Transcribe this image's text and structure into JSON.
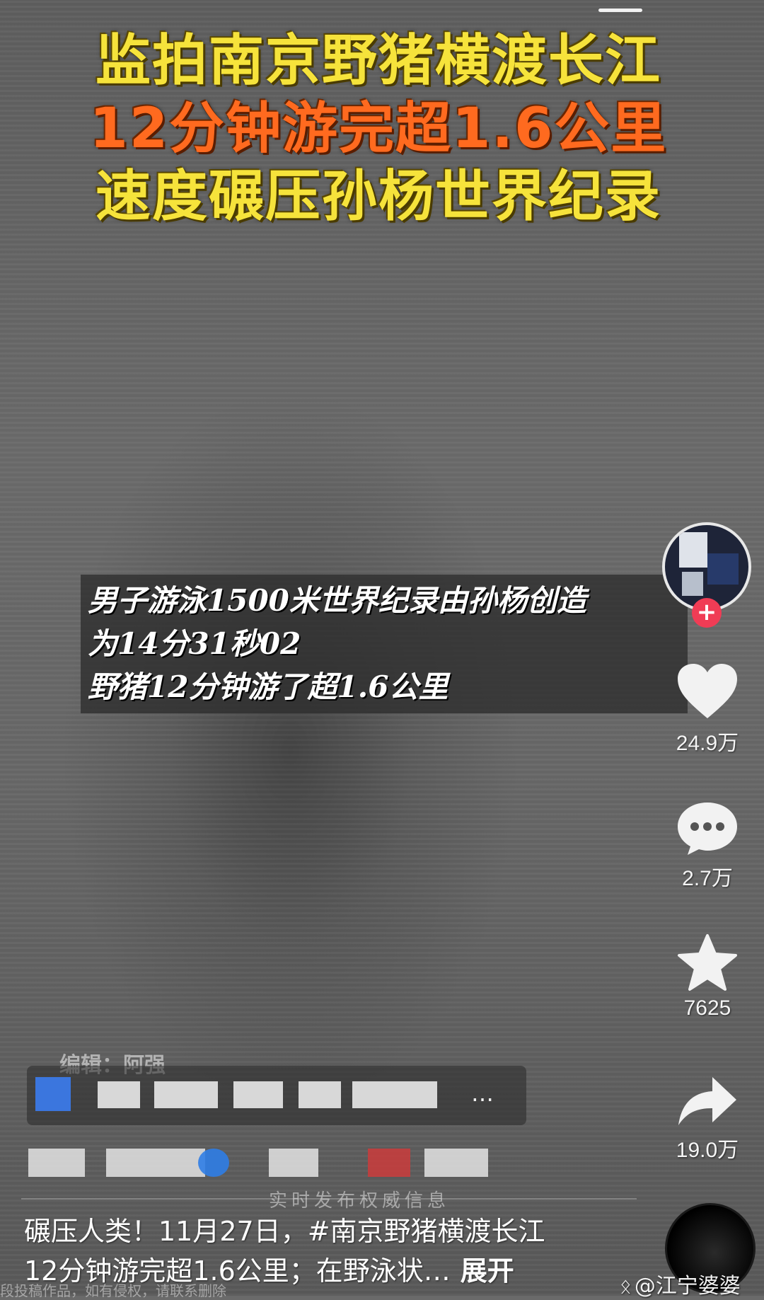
{
  "title": {
    "line1": "监拍南京野猪横渡长江",
    "line2": "12分钟游完超1.6公里",
    "line3": "速度碾压孙杨世界纪录"
  },
  "caption": {
    "line1": "男子游泳1500米世界纪录由孙杨创造",
    "line2": "为14分31秒02",
    "line3": "野猪12分钟游了超1.6公里"
  },
  "side_actions": {
    "like_count": "24.9万",
    "comment_count": "2.7万",
    "favorite_count": "7625",
    "share_count": "19.0万",
    "follow_symbol": "+"
  },
  "overlay": {
    "editor": "编辑：阿强",
    "ellipsis": "…",
    "watermark": "实时发布权威信息"
  },
  "description": {
    "text_line1_prefix": "碾压人类！11月27日，",
    "hashtag": "#南京野猪横渡长江",
    "text_line2": "12分钟游完超1.6公里；在野泳状…",
    "expand": "展开"
  },
  "footer": {
    "weibo_watermark": "@江宁婆婆",
    "disclaimer": "段投稿作品，如有侵权，请联系删除"
  },
  "colors": {
    "title_yellow": "#f6e33b",
    "title_orange": "#ff6a1f",
    "follow_red": "#f03c55"
  },
  "icons": [
    "heart-icon",
    "comment-icon",
    "star-icon",
    "share-icon",
    "weibo-icon"
  ]
}
